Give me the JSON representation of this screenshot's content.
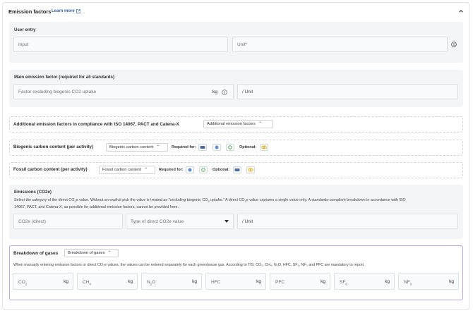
{
  "header": {
    "title": "Emission factors",
    "learn_more": "Learn more"
  },
  "user_entry": {
    "title": "User entry",
    "input_placeholder": "Input",
    "unit_placeholder": "Unit*"
  },
  "main_factor": {
    "title": "Main emission factor (required for all standards)",
    "placeholder": "Factor excluding biogenic CO2 uptake",
    "unit": "kg",
    "per_unit": "/ Unit"
  },
  "additional": {
    "title": "Additional emission factors in compliance with ISO 14067, PACT and Catena-X",
    "dropdown": "Additional emission factors"
  },
  "biogenic": {
    "title": "Biogenic carbon content (per activity)",
    "dropdown": "Biogenic carbon content",
    "required_label": "Required for:",
    "optional_label": "Optional:"
  },
  "fossil": {
    "title": "Fossil carbon content (per activity)",
    "dropdown": "Fossil carbon content",
    "required_label": "Required for:",
    "optional_label": "Optional:"
  },
  "emissions": {
    "title": "Emissions (CO2e)",
    "desc_1": "Select the category of the direct CO",
    "desc_1_sub": "2",
    "desc_2": "e value. Without an explicit pick the value is treated as \"excluding biogenic CO",
    "desc_2_sub": "2",
    "desc_3": " uptake.\" A direct CO",
    "desc_3_sub": "2",
    "desc_4": "e value captures a single value only. A standards-compliant breakdown in accordance with ISO",
    "desc_line2": "14067, PACT, and Catena-X, as possible for additional emission factors, cannot be provided here.",
    "direct_placeholder": "CO2e (direct)",
    "type_placeholder": "Type of direct CO2e value",
    "per_unit": "/ Unit"
  },
  "breakdown": {
    "title": "Breakdown of gases",
    "dropdown": "Breakdown of gases",
    "desc": "When manually entering emission factors or direct CO₂e values, the values can be entered separately for each greenhouse gas. According to TfS, CO₂, CH₄, N₂O, HFC, SF₆, NF₃ and PFC are mandatory to report.",
    "unit": "kg",
    "gases": [
      {
        "name": "CO",
        "sub": "2"
      },
      {
        "name": "CH",
        "sub": "4"
      },
      {
        "name": "N",
        "sub": "2",
        "suffix": "O"
      },
      {
        "name": "HFC",
        "sub": ""
      },
      {
        "name": "PFC",
        "sub": ""
      },
      {
        "name": "SF",
        "sub": "6"
      },
      {
        "name": "NF",
        "sub": "3"
      }
    ]
  },
  "colors": {
    "accent": "#2a5db0",
    "breakdown_border": "#b7a6e3"
  }
}
